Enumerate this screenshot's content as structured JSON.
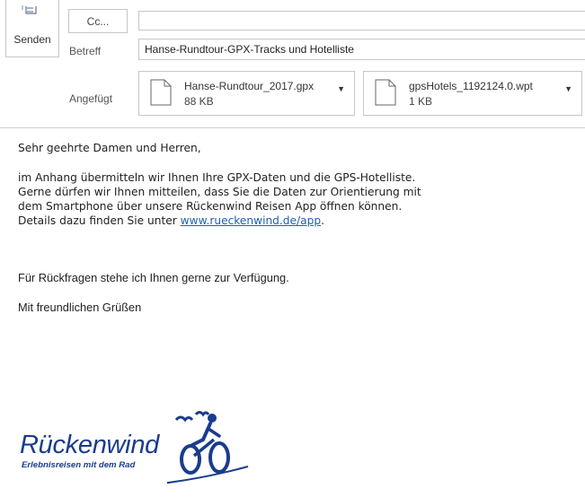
{
  "header": {
    "send_label": "Senden",
    "cc_label": "Cc...",
    "cc_value": "",
    "subject_label": "Betreff",
    "subject_value": "Hanse-Rundtour-GPX-Tracks und Hotelliste",
    "attached_label": "Angefügt"
  },
  "attachments": [
    {
      "name": "Hanse-Rundtour_2017.gpx",
      "size": "88 KB",
      "icon": "file-icon"
    },
    {
      "name": "gpsHotels_1192124.0.wpt",
      "size": "1 KB",
      "icon": "file-icon"
    }
  ],
  "body": {
    "greeting": "Sehr geehrte Damen und Herren,",
    "para1_line1": "im Anhang übermitteln wir Ihnen Ihre GPX-Daten und die GPS-Hotelliste.",
    "para1_line2": "Gerne dürfen wir Ihnen mitteilen, dass Sie die Daten zur Orientierung mit",
    "para1_line3": "dem Smartphone über unsere Rückenwind Reisen App öffnen können.",
    "para1_line4_prefix": "Details dazu finden Sie unter ",
    "link_text": "www.rueckenwind.de/app",
    "para1_line4_suffix": ".",
    "questions": "Für Rückfragen stehe ich Ihnen gerne zur Verfügung.",
    "closing": "Mit freundlichen Grüßen"
  },
  "logo": {
    "brand": "Rückenwind",
    "tagline": "Erlebnisreisen mit dem Rad",
    "color": "#1b3c8d"
  },
  "colors": {
    "border": "#c6c6c6",
    "link": "#1f5fb3"
  }
}
